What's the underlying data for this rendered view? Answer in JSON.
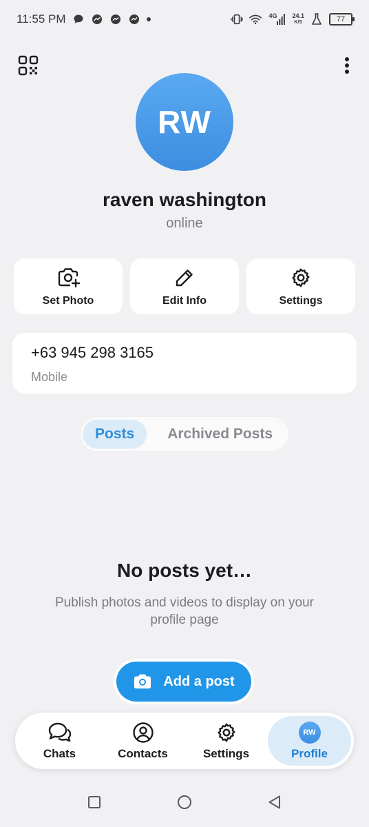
{
  "status_bar": {
    "time": "11:55 PM",
    "notification_icons": [
      "chat-bubble-icon",
      "messenger-icon",
      "messenger-icon",
      "messenger-icon"
    ],
    "network_type": "4G",
    "speed_value": "24.1",
    "speed_unit": "K/S",
    "battery": "77"
  },
  "profile": {
    "initials": "RW",
    "name": "raven washington",
    "status": "online"
  },
  "actions": [
    {
      "label": "Set Photo",
      "icon": "camera-plus-icon"
    },
    {
      "label": "Edit Info",
      "icon": "pencil-icon"
    },
    {
      "label": "Settings",
      "icon": "gear-icon"
    }
  ],
  "phone": {
    "number": "+63 945 298 3165",
    "label": "Mobile"
  },
  "tabs": [
    {
      "label": "Posts",
      "active": true
    },
    {
      "label": "Archived Posts",
      "active": false
    }
  ],
  "empty_state": {
    "title": "No posts yet…",
    "description": "Publish photos and videos to display on your profile page",
    "button_label": "Add a post"
  },
  "bottom_nav": [
    {
      "label": "Chats",
      "icon": "chats-icon"
    },
    {
      "label": "Contacts",
      "icon": "contact-icon"
    },
    {
      "label": "Settings",
      "icon": "gear-icon"
    },
    {
      "label": "Profile",
      "icon": "avatar",
      "initials": "RW",
      "active": true
    }
  ],
  "colors": {
    "accent": "#2196e8",
    "avatar_top": "#5aa9f2",
    "avatar_bottom": "#3d8ee0",
    "background": "#f1f1f4",
    "active_tab_bg": "#dcebf8"
  }
}
